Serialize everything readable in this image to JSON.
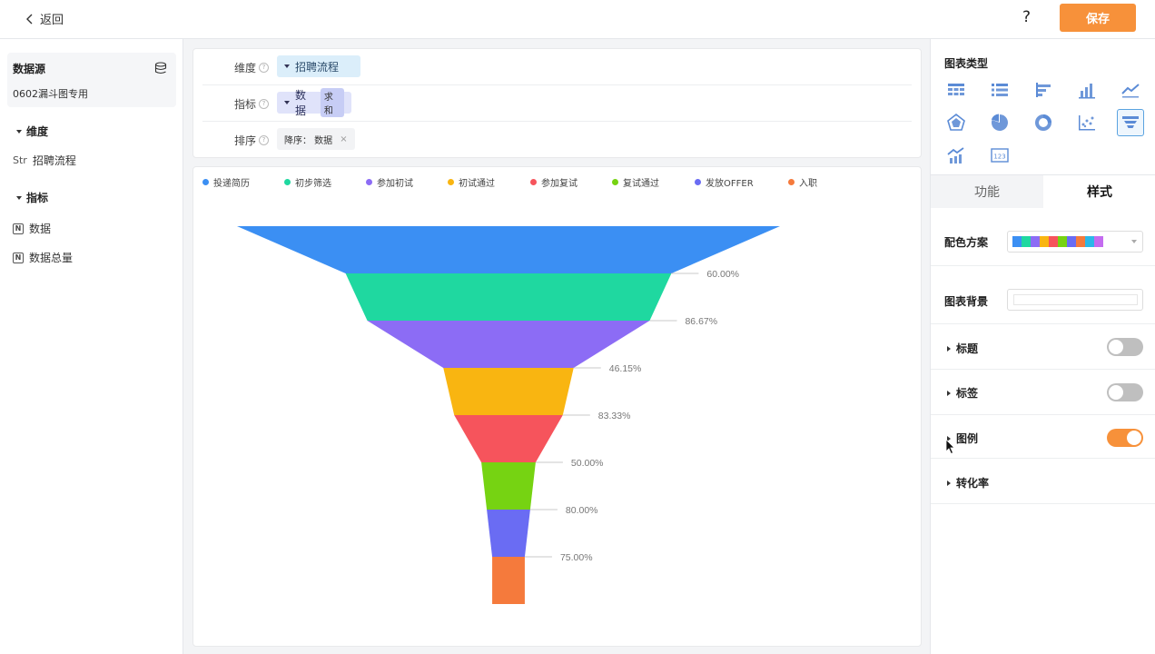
{
  "topbar": {
    "back_label": "返回",
    "help_label": "?",
    "save_label": "保存"
  },
  "left": {
    "datasource_title": "数据源",
    "datasource_name": "0602漏斗图专用",
    "dimension_section": "维度",
    "dimension_fields": [
      {
        "type": "Str",
        "name": "招聘流程"
      }
    ],
    "metric_section": "指标",
    "metric_fields": [
      {
        "type": "N",
        "name": "数据"
      },
      {
        "type": "N",
        "name": "数据总量"
      }
    ]
  },
  "config": {
    "dimension_label": "维度",
    "dimension_value": "招聘流程",
    "metric_label": "指标",
    "metric_value": "数据",
    "metric_agg": "求和",
    "sort_label": "排序",
    "sort_value": "降序： 数据",
    "sort_remove": "×"
  },
  "chart_data": {
    "type": "funnel",
    "categories": [
      "投递简历",
      "初步筛选",
      "参加初试",
      "初试通过",
      "参加复试",
      "复试通过",
      "发放OFFER",
      "入职"
    ],
    "colors": [
      "#3b8ff3",
      "#1fd8a0",
      "#8c6cf5",
      "#f9b511",
      "#f6545c",
      "#76d312",
      "#6a6cf3",
      "#f57a3c"
    ],
    "conversion_rates": [
      "60.00%",
      "86.67%",
      "46.15%",
      "83.33%",
      "50.00%",
      "80.00%",
      "75.00%"
    ],
    "relative_values": [
      1,
      0.6,
      0.52,
      0.24,
      0.2,
      0.1,
      0.08,
      0.06
    ],
    "legend_position": "top"
  },
  "right": {
    "chart_type_title": "图表类型",
    "chart_types": [
      "table-icon",
      "list-icon",
      "horizontal-bar-icon",
      "bar-chart-icon",
      "line-chart-icon",
      "radar-icon",
      "pie-icon",
      "donut-icon",
      "scatter-icon",
      "funnel-icon",
      "combo-chart-icon",
      "number-card-icon"
    ],
    "selected_type": "funnel-icon",
    "tab_function": "功能",
    "tab_style": "样式",
    "color_scheme_label": "配色方案",
    "color_scheme": [
      "#3b8ff3",
      "#1fd8a0",
      "#8c6cf5",
      "#f9b511",
      "#f6545c",
      "#76d312",
      "#6a6cf3",
      "#f57a3c",
      "#2bb8e8",
      "#c46cf0"
    ],
    "bg_label": "图表背景",
    "sections": [
      {
        "label": "标题",
        "toggle": false
      },
      {
        "label": "标签",
        "toggle": false
      },
      {
        "label": "图例",
        "toggle": true
      },
      {
        "label": "转化率"
      }
    ]
  }
}
